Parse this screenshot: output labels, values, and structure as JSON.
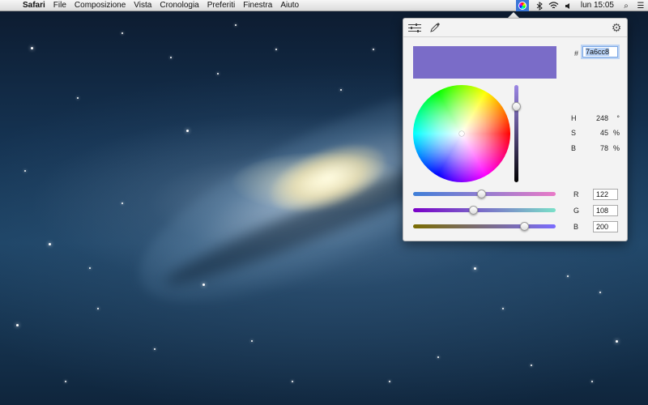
{
  "menubar": {
    "apple_icon": "",
    "app_name": "Safari",
    "items": [
      "File",
      "Composizione",
      "Vista",
      "Cronologia",
      "Preferiti",
      "Finestra",
      "Aiuto"
    ],
    "clock": "lun 15:05",
    "status_icons": [
      "colorpicker-icon",
      "bluetooth-icon",
      "wifi-icon",
      "volume-icon"
    ],
    "search_icon": "⌕",
    "list_icon": "☰"
  },
  "picker": {
    "gear_icon": "⚙",
    "hex_label": "#",
    "hex_value": "7a6cc8",
    "swatch_color": "#7a6cc8",
    "brightness_fraction": 0.78,
    "hsb": [
      {
        "label": "H",
        "value": "248",
        "unit": "°"
      },
      {
        "label": "S",
        "value": "45",
        "unit": "%"
      },
      {
        "label": "B",
        "value": "78",
        "unit": "%"
      }
    ],
    "rgb": [
      {
        "label": "R",
        "value": "122",
        "fraction": 0.478
      },
      {
        "label": "G",
        "value": "108",
        "fraction": 0.424
      },
      {
        "label": "B",
        "value": "200",
        "fraction": 0.784
      }
    ],
    "colors": {
      "r_track": [
        "#3e7fd8",
        "#e97ac7"
      ],
      "g_track": [
        "#7a00c8",
        "#7ae0c8"
      ],
      "b_track": [
        "#7a6c00",
        "#7a6cff"
      ]
    }
  }
}
